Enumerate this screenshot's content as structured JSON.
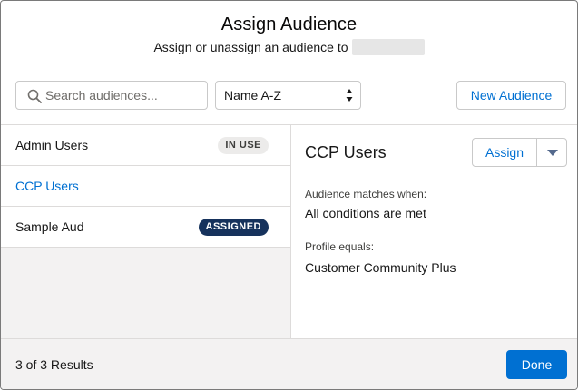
{
  "header": {
    "title": "Assign Audience",
    "subtitle": "Assign or unassign an audience to"
  },
  "toolbar": {
    "search_placeholder": "Search audiences...",
    "sort_value": "Name A-Z",
    "new_audience_label": "New Audience"
  },
  "list": {
    "items": [
      {
        "name": "Admin Users",
        "badge": "IN USE"
      },
      {
        "name": "CCP Users",
        "badge": ""
      },
      {
        "name": "Sample Aud",
        "badge": "ASSIGNED"
      }
    ]
  },
  "detail": {
    "title": "CCP Users",
    "assign_label": "Assign",
    "fields": [
      {
        "label": "Audience matches when:",
        "value": "All conditions are met"
      },
      {
        "label": "Profile equals:",
        "value": "Customer Community Plus"
      }
    ]
  },
  "footer": {
    "results": "3 of 3 Results",
    "done_label": "Done"
  },
  "colors": {
    "brand": "#0070d2",
    "assigned_badge": "#16325c",
    "inuse_badge": "#ecebea"
  }
}
